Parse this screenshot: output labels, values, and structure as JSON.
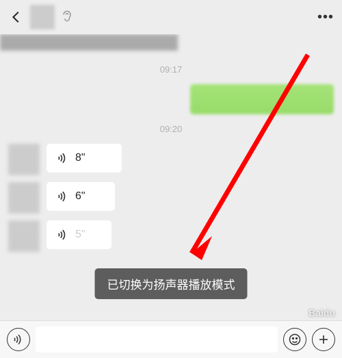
{
  "header": {
    "more": "•••"
  },
  "chat": {
    "ts1": "09:17",
    "ts2": "09:20",
    "voices": [
      {
        "duration": "8\""
      },
      {
        "duration": "6\""
      },
      {
        "duration": "5\""
      }
    ]
  },
  "toast": {
    "text": "已切换为扬声器播放模式"
  },
  "watermark": "Baidu"
}
